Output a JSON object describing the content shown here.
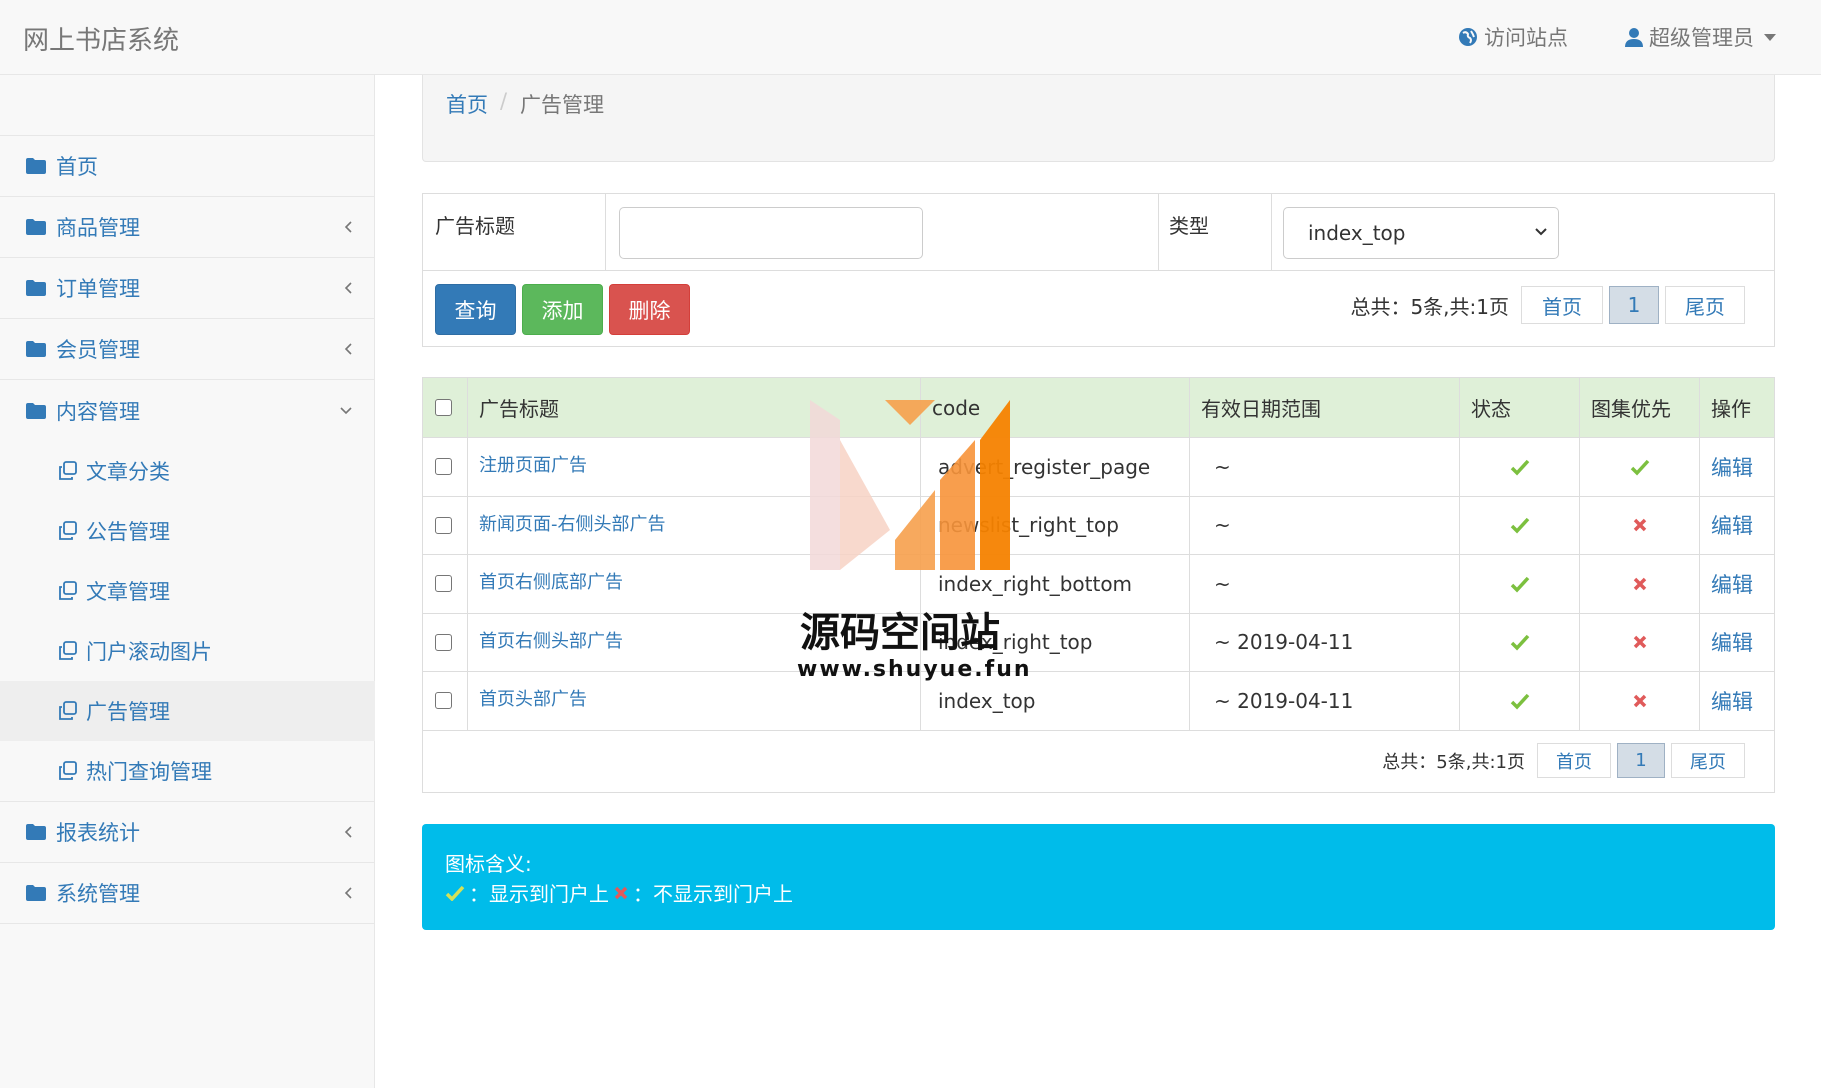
{
  "header": {
    "brand": "网上书店系统",
    "visit_label": "访问站点",
    "user_label": "超级管理员"
  },
  "sidebar": {
    "items": [
      {
        "label": "首页"
      },
      {
        "label": "商品管理"
      },
      {
        "label": "订单管理"
      },
      {
        "label": "会员管理"
      },
      {
        "label": "内容管理"
      },
      {
        "label": "报表统计"
      },
      {
        "label": "系统管理"
      }
    ],
    "content_sub": [
      {
        "label": "文章分类"
      },
      {
        "label": "公告管理"
      },
      {
        "label": "文章管理"
      },
      {
        "label": "门户滚动图片"
      },
      {
        "label": "广告管理"
      },
      {
        "label": "热门查询管理"
      }
    ]
  },
  "breadcrumb": {
    "home": "首页",
    "sep": "/",
    "current": "广告管理"
  },
  "search": {
    "title_label": "广告标题",
    "title_value": "",
    "type_label": "类型",
    "type_selected": "index_top",
    "query_label": "查询",
    "add_label": "添加",
    "delete_label": "删除"
  },
  "pager": {
    "total": "总共：5条,共:1页",
    "first": "首页",
    "current": "1",
    "last": "尾页"
  },
  "table": {
    "headers": {
      "title": "广告标题",
      "code": "code",
      "date": "有效日期范围",
      "status": "状态",
      "gallery": "图集优先",
      "op": "操作"
    },
    "rows": [
      {
        "title": "注册页面广告",
        "code": "advert_register_page",
        "date": "~",
        "status": "yes",
        "gallery": "yes",
        "op": "编辑"
      },
      {
        "title": "新闻页面-右侧头部广告",
        "code": "newslist_right_top",
        "date": "~",
        "status": "yes",
        "gallery": "no",
        "op": "编辑"
      },
      {
        "title": "首页右侧底部广告",
        "code": "index_right_bottom",
        "date": "~",
        "status": "yes",
        "gallery": "no",
        "op": "编辑"
      },
      {
        "title": "首页右侧头部广告",
        "code": "index_right_top",
        "date": "~ 2019-04-11",
        "status": "yes",
        "gallery": "no",
        "op": "编辑"
      },
      {
        "title": "首页头部广告",
        "code": "index_top",
        "date": "~ 2019-04-11",
        "status": "yes",
        "gallery": "no",
        "op": "编辑"
      }
    ]
  },
  "info": {
    "title": "图标含义:",
    "yes_text": "：显示到门户上",
    "no_text": "：不显示到门户上"
  },
  "watermark": {
    "name": "源码空间站",
    "url": "www.shuyue.fun"
  },
  "colors": {
    "link": "#337ab7",
    "check": "#7cc03f",
    "cross": "#e05a5a",
    "info_bg": "#00bcea"
  }
}
